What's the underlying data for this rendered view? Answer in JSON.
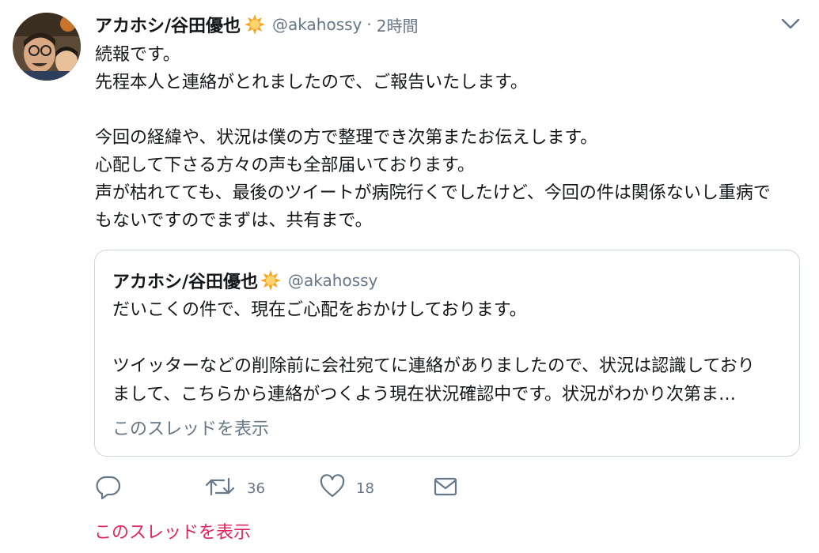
{
  "tweet": {
    "author_name": "アカホシ/谷田優也",
    "handle": "@akahossy",
    "separator": "·",
    "time": "2時間",
    "lines": [
      "続報です。",
      "先程本人と連絡がとれましたので、ご報告いたします。",
      "",
      "今回の経緯や、状況は僕の方で整理でき次第またお伝えします。",
      "心配して下さる方々の声も全部届いております。",
      "声が枯れてても、最後のツイートが病院行くでしたけど、今回の件は関係ないし重病で",
      "もないですのでまずは、共有まで。"
    ]
  },
  "quote": {
    "author_name": "アカホシ/谷田優也",
    "handle": "@akahossy",
    "lines": [
      "だいこくの件で、現在ご心配をおかけしております。",
      "",
      "ツイッターなどの削除前に会社宛てに連絡がありましたので、状況は認識しており",
      "まして、こちらから連絡がつくよう現在状況確認中です。状況がわかり次第ま…"
    ],
    "show_thread": "このスレッドを表示"
  },
  "actions": {
    "reply_count": "",
    "retweet_count": "36",
    "like_count": "18"
  },
  "show_thread_link": "このスレッドを表示",
  "colors": {
    "text": "#14171a",
    "secondary": "#657786",
    "link_pink": "#e0245e",
    "border": "#ccd6dd",
    "badge": "#f5a623"
  },
  "icons": {
    "badge": "sun-badge-icon",
    "caret": "chevron-down-icon",
    "reply": "reply-icon",
    "retweet": "retweet-icon",
    "like": "heart-icon",
    "dm": "envelope-icon"
  }
}
